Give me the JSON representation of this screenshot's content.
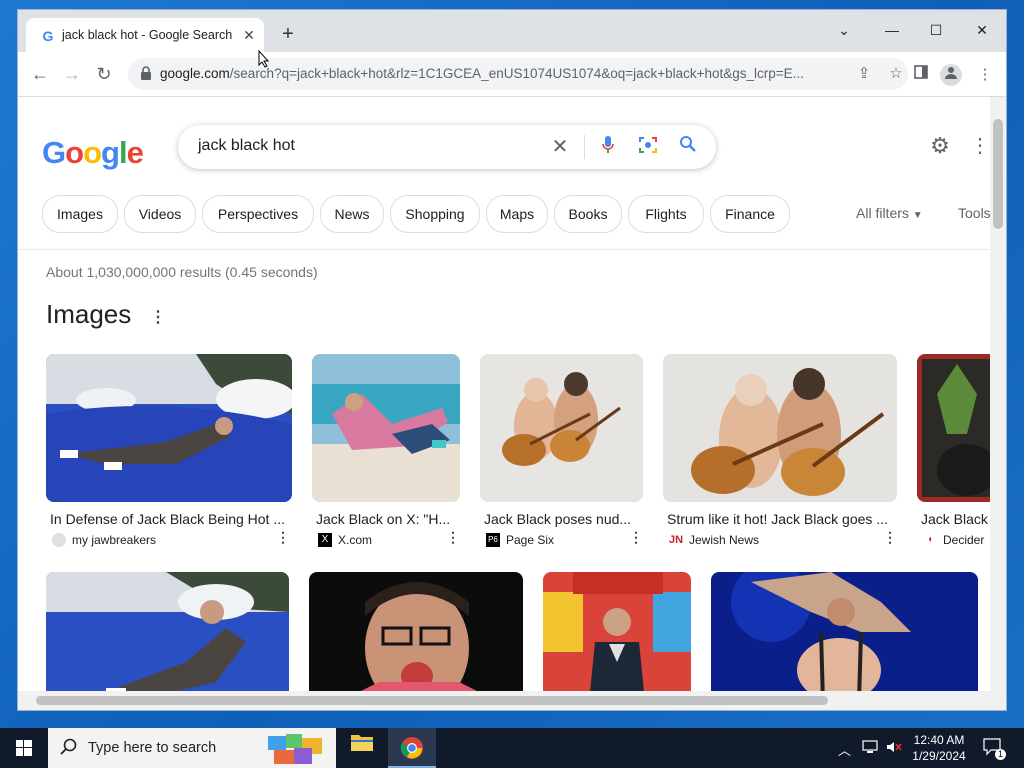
{
  "browser": {
    "tab_title": "jack black hot - Google Search",
    "tab_favicon": "G",
    "url_host": "google.com",
    "url_rest": "/search?q=jack+black+hot&rlz=1C1GCEA_enUS1074US1074&oq=jack+black+hot&gs_lcrp=E..."
  },
  "search": {
    "query": "jack black hot",
    "chips": [
      "Images",
      "Videos",
      "Perspectives",
      "News",
      "Shopping",
      "Maps",
      "Books",
      "Flights",
      "Finance"
    ],
    "all_filters": "All filters",
    "tools": "Tools",
    "results_count": "About 1,030,000,000 results (0.45 seconds)",
    "images_heading": "Images"
  },
  "image_cards": [
    {
      "title": "In Defense of Jack Black Being Hot ...",
      "source": "my jawbreakers"
    },
    {
      "title": "Jack Black on X: \"H...",
      "source": "X.com"
    },
    {
      "title": "Jack Black poses nud...",
      "source": "Page Six"
    },
    {
      "title": "Strum like it hot! Jack Black goes ...",
      "source": "Jewish News"
    },
    {
      "title": "Jack Black",
      "source": "Decider"
    }
  ],
  "taskbar": {
    "search_placeholder": "Type here to search",
    "time": "12:40 AM",
    "date": "1/29/2024",
    "notification_count": "1"
  }
}
